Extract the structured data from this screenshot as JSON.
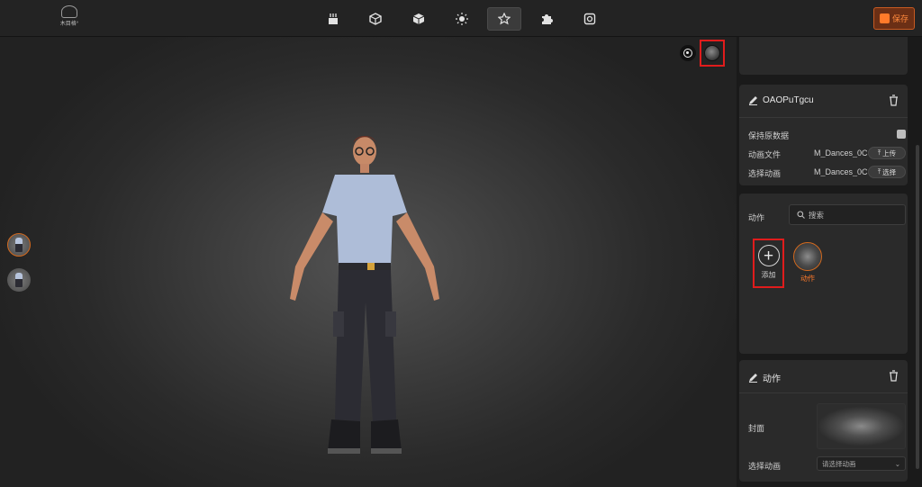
{
  "app": {
    "logo_text": "木目格°",
    "save_label": "保存",
    "accent": "#ff7a2a",
    "highlight": "#e01c1c"
  },
  "toolbar": {
    "tools": [
      {
        "icon": "scene-icon"
      },
      {
        "icon": "box-icon"
      },
      {
        "icon": "cube-icon"
      },
      {
        "icon": "light-icon"
      },
      {
        "icon": "star-icon",
        "active": true
      },
      {
        "icon": "puzzle-icon"
      },
      {
        "icon": "camera-icon"
      }
    ]
  },
  "animation_card": {
    "title": "OAOPuTgcu",
    "keep_data_label": "保持原数据",
    "anim_file_label": "动画文件",
    "anim_file_value": "M_Dances_0C",
    "upload_label": "上传",
    "select_anim_label": "选择动画",
    "select_anim_value": "M_Dances_0C",
    "select_label": "选择"
  },
  "actions_card": {
    "label": "动作",
    "search_placeholder": "搜索",
    "add_label": "添加",
    "item_label": "动作"
  },
  "action_detail_card": {
    "title": "动作",
    "cover_label": "封面",
    "select_anim_label": "选择动画",
    "select_placeholder": "请选择动画"
  }
}
